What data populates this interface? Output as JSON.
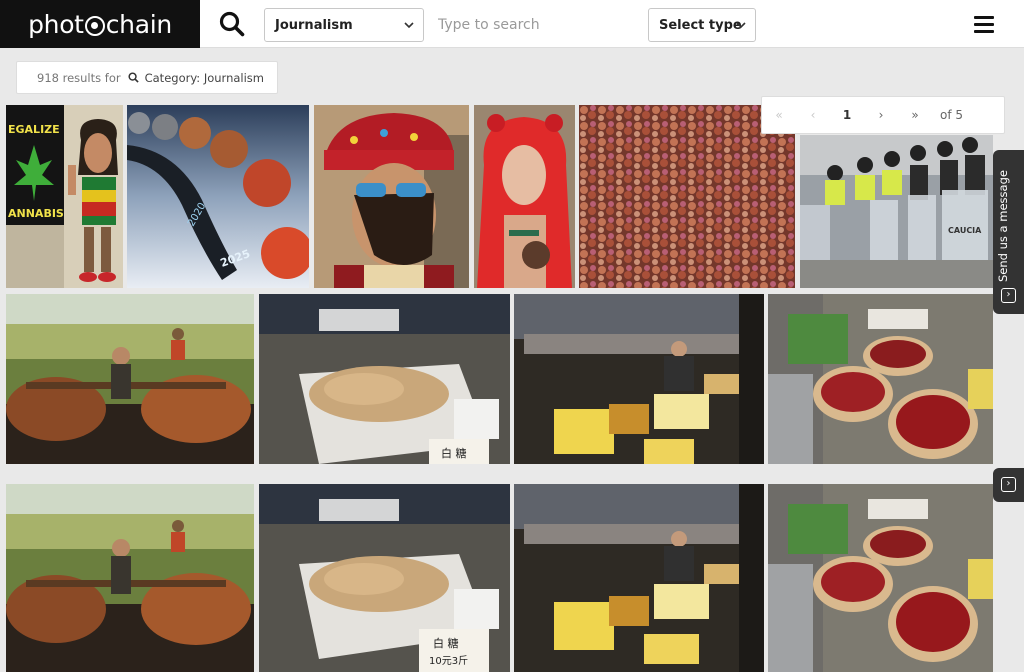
{
  "header": {
    "logo_prefix": "phot",
    "logo_suffix": "chain",
    "category_selected": "Journalism",
    "search_placeholder": "Type to search",
    "type_selected": "Select type"
  },
  "results": {
    "count_text": "918 results for",
    "category_text": "Category: Journalism"
  },
  "pagination": {
    "first_glyph": "«",
    "prev_glyph": "‹",
    "current_page": "1",
    "next_glyph": "›",
    "last_glyph": "»",
    "of_text": "of 5"
  },
  "side_tab": {
    "label": "Send us a message",
    "icon_glyph": "›"
  },
  "side_tab_secondary": {
    "icon_glyph": "›"
  },
  "image_texts": {
    "legalize": "EGALIZE",
    "cannabis": "ANNABIS",
    "year_2020": "2020",
    "year_2025": "2025",
    "police": "CAUCIA",
    "sign_sugar": "白 糖",
    "sign_price": "10元3斤"
  },
  "colors": {
    "logo_bg": "#111111",
    "side_tab_bg": "#333333",
    "page_bg": "#e9e9e9"
  },
  "icons": [
    "search-icon",
    "chevron-down-icon",
    "hamburger-menu-icon",
    "chevron-right-icon"
  ]
}
